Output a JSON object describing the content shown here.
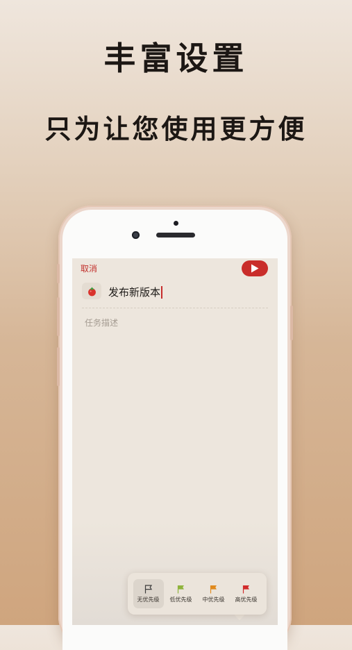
{
  "headline": {
    "title": "丰富设置",
    "subtitle": "只为让您使用更方便"
  },
  "editor": {
    "cancel_label": "取消",
    "task_title": "发布新版本",
    "description_placeholder": "任务描述",
    "icons": {
      "submit": "play-icon",
      "category": "tomato-icon"
    }
  },
  "priority": {
    "selected": 0,
    "options": [
      {
        "label": "无优先级",
        "icon": "flag-outline-icon",
        "color": "#3c3c3c"
      },
      {
        "label": "低优先级",
        "icon": "flag-icon",
        "color": "#8fb33c"
      },
      {
        "label": "中优先级",
        "icon": "flag-icon",
        "color": "#e08a1e"
      },
      {
        "label": "高优先级",
        "icon": "flag-icon",
        "color": "#d12b2b"
      }
    ]
  },
  "colors": {
    "accent": "#c92d2a",
    "screen_background": "#ede6dd"
  }
}
